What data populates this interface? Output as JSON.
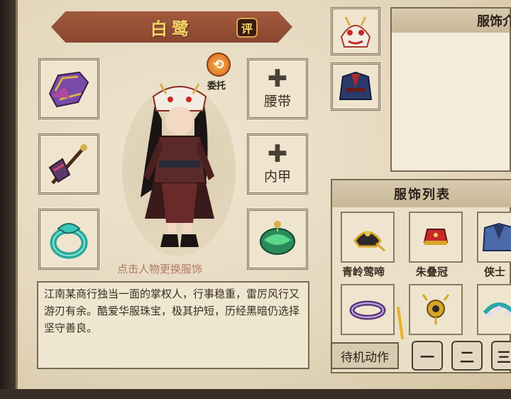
{
  "header": {
    "name": "白鹭",
    "rating_label": "评"
  },
  "entrust": {
    "label": "委托",
    "icon": "refresh-arrows-icon"
  },
  "slots": {
    "left": [
      {
        "item": "purple-bracer",
        "icon": "purple-bracer-icon"
      },
      {
        "item": "dark-hammer-weapon",
        "icon": "hammer-weapon-icon"
      },
      {
        "item": "jade-ring",
        "icon": "jade-ring-icon"
      }
    ],
    "right": [
      {
        "label": "腰带",
        "icon": "plus-icon"
      },
      {
        "label": "内甲",
        "icon": "plus-icon"
      },
      {
        "item": "green-jade-pendant",
        "icon": "jade-pendant-icon"
      }
    ]
  },
  "character_hint": "点击人物更换服饰",
  "description": "江南某商行独当一面的掌权人，行事稳重，雷厉风行又游刃有余。酷爱华服珠宝，极其护短，历经黑暗仍选择坚守善良。",
  "side_slots": [
    {
      "item": "dragon-hat",
      "icon": "dragon-hat-icon"
    },
    {
      "item": "dark-robe",
      "icon": "robe-icon"
    }
  ],
  "intro_panel": {
    "title": "服饰介"
  },
  "outfit_list": {
    "title": "服饰列表",
    "items": [
      {
        "label": "青岭莺啼",
        "icon": "gold-headpiece-icon"
      },
      {
        "label": "朱叠冠",
        "icon": "red-crown-icon"
      },
      {
        "label": "侠士",
        "icon": "blue-robe-icon"
      },
      {
        "label": "",
        "icon": "purple-bracelet-icon"
      },
      {
        "label": "",
        "icon": "gold-ornament-icon"
      },
      {
        "label": "",
        "icon": "teal-ornament-icon"
      }
    ]
  },
  "idle_action_label": "待机动作",
  "pose_buttons": [
    "一",
    "二",
    "三"
  ]
}
